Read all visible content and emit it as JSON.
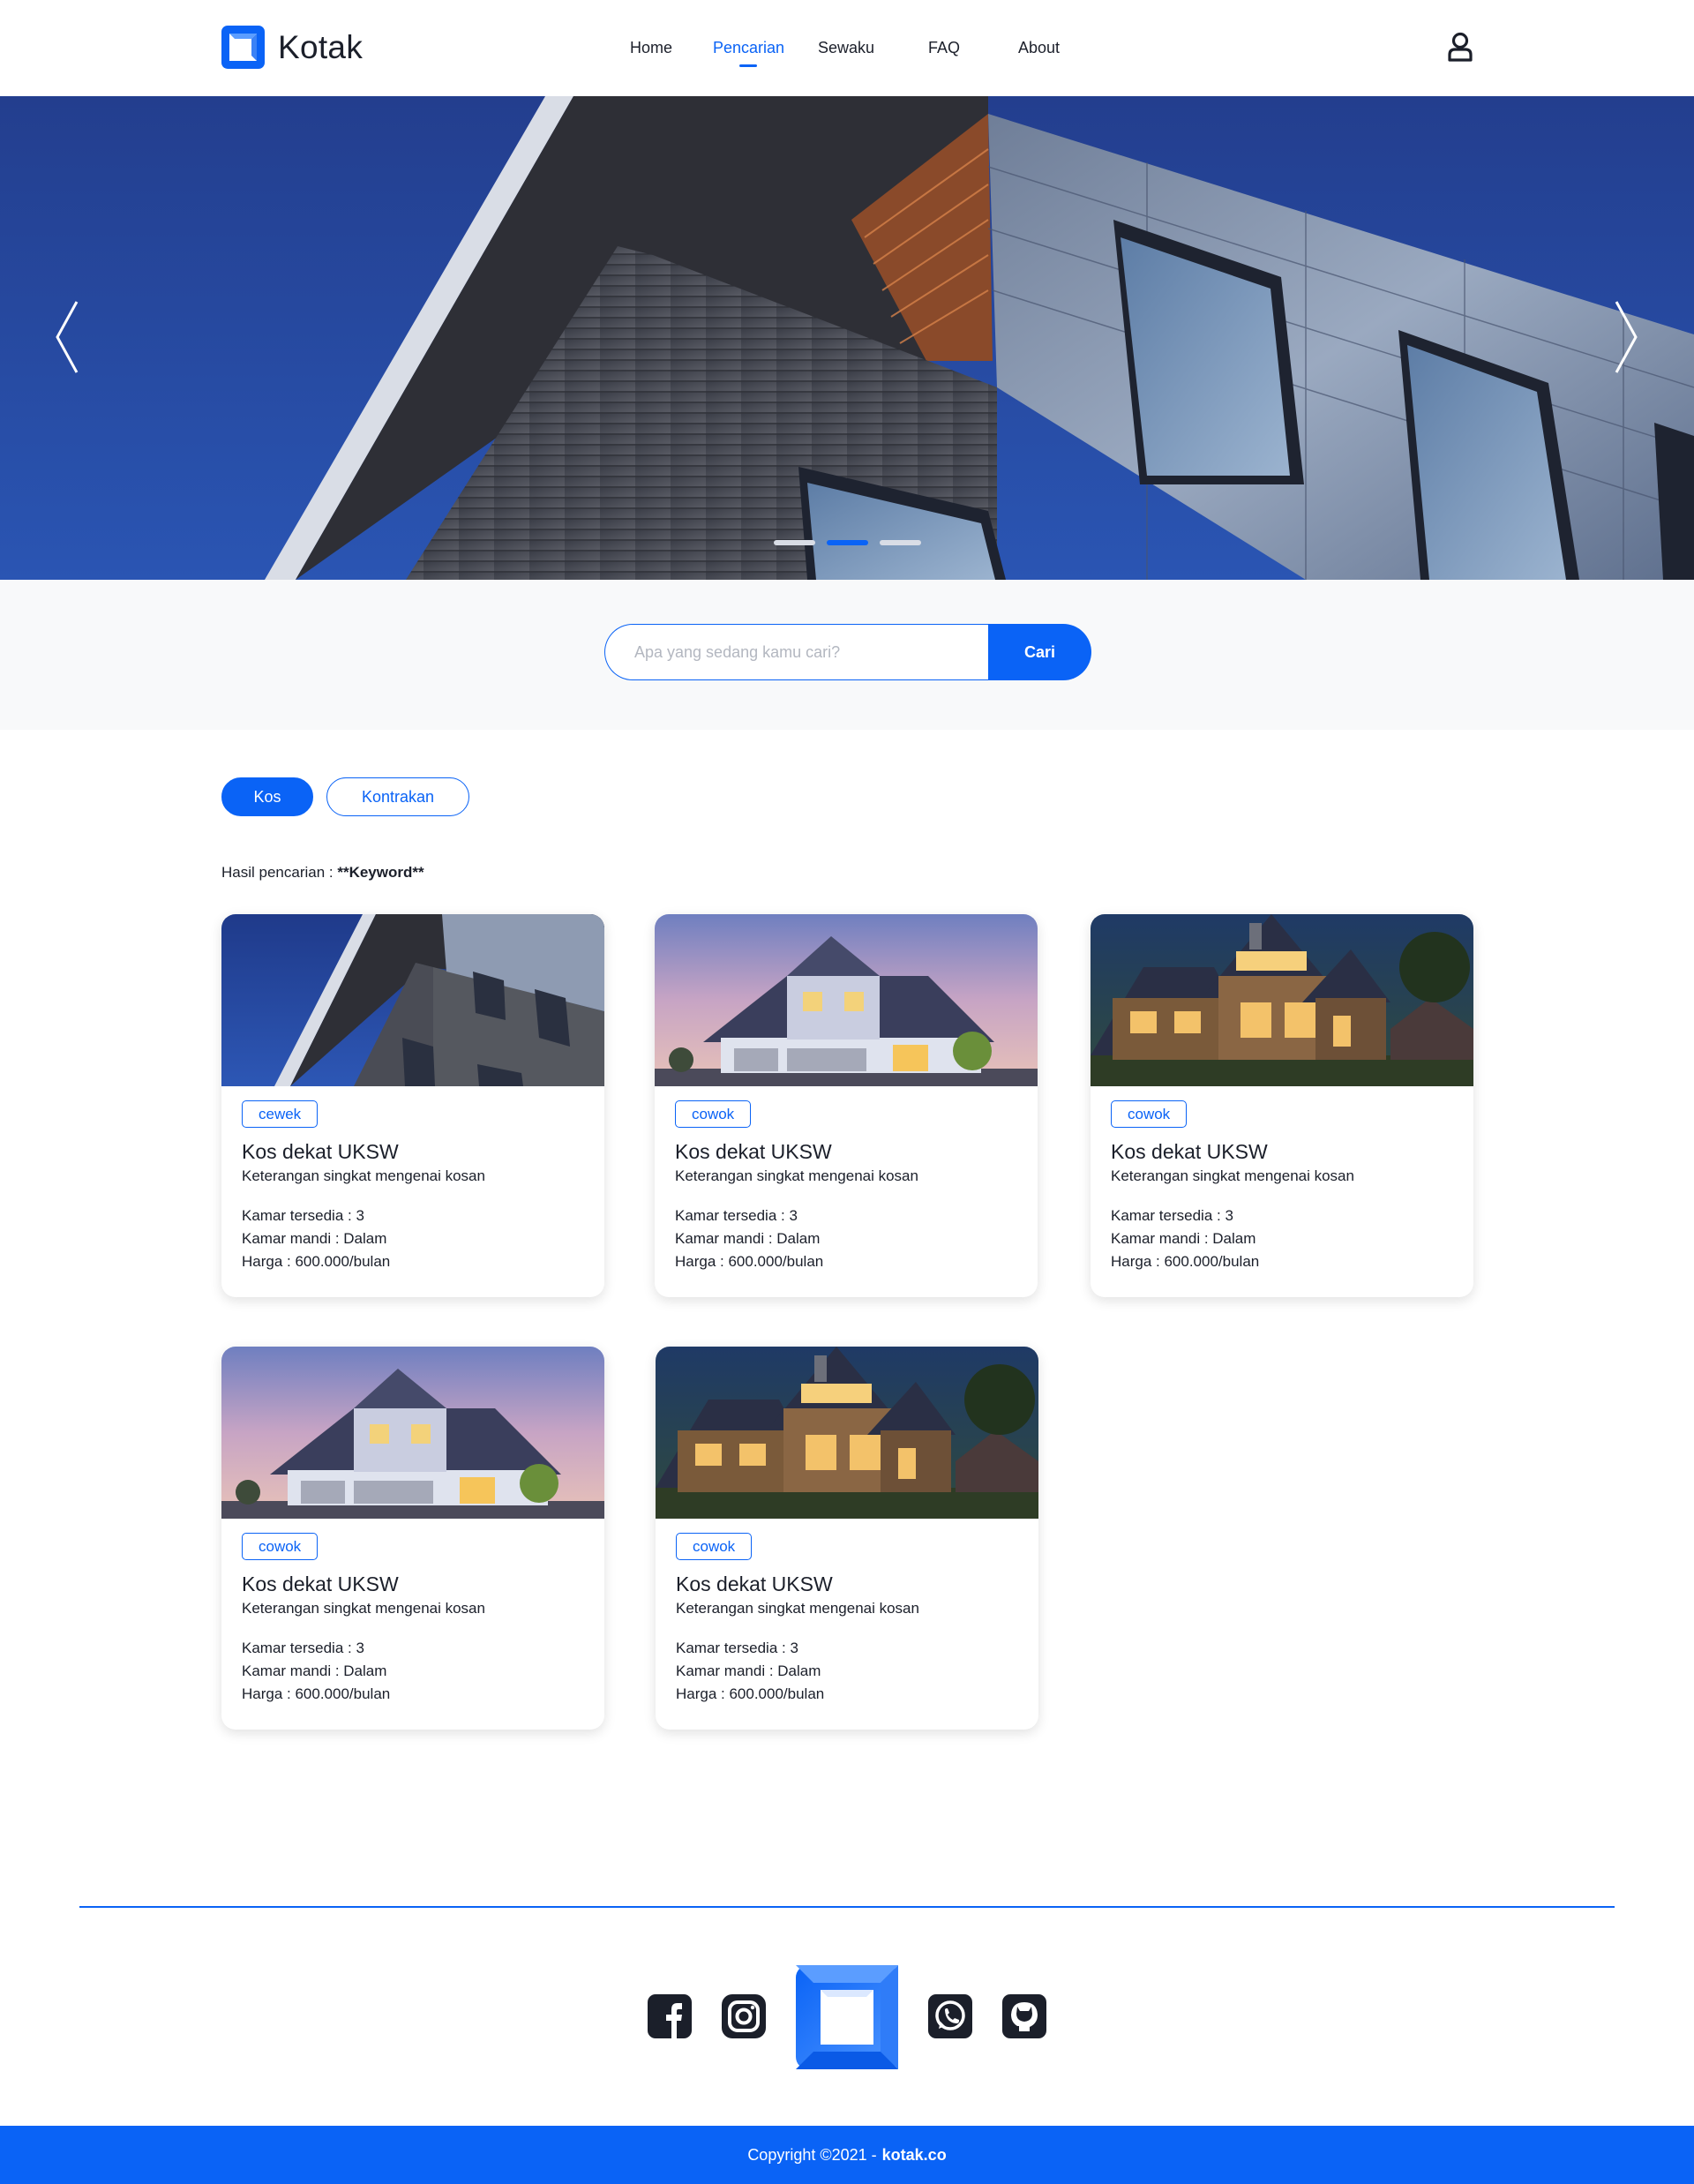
{
  "app": {
    "name": "Kotak"
  },
  "nav": {
    "items": [
      {
        "label": "Home"
      },
      {
        "label": "Pencarian",
        "active": true
      },
      {
        "label": "Sewaku"
      },
      {
        "label": "FAQ"
      },
      {
        "label": "About"
      }
    ],
    "user_icon": "user-icon"
  },
  "hero": {
    "slide_count": 3,
    "active_slide": 2,
    "prev_icon": "chevron-left-icon",
    "next_icon": "chevron-right-icon"
  },
  "search": {
    "placeholder": "Apa yang sedang kamu cari?",
    "value": "",
    "button_label": "Cari"
  },
  "filters": [
    {
      "label": "Kos",
      "active": true
    },
    {
      "label": "Kontrakan",
      "active": false
    }
  ],
  "results": {
    "prefix": "Hasil pencarian : ",
    "keyword": "**Keyword**"
  },
  "listings": [
    {
      "tag": "cewek",
      "title": "Kos dekat UKSW",
      "description": "Keterangan singkat mengenai kosan",
      "rooms": "Kamar tersedia : 3",
      "bathroom": "Kamar mandi : Dalam",
      "price": "Harga : 600.000/bulan",
      "image": "modern-building"
    },
    {
      "tag": "cowok",
      "title": "Kos dekat UKSW",
      "description": "Keterangan singkat mengenai kosan",
      "rooms": "Kamar tersedia : 3",
      "bathroom": "Kamar mandi : Dalam",
      "price": "Harga : 600.000/bulan",
      "image": "suburban-house-dusk"
    },
    {
      "tag": "cowok",
      "title": "Kos dekat UKSW",
      "description": "Keterangan singkat mengenai kosan",
      "rooms": "Kamar tersedia : 3",
      "bathroom": "Kamar mandi : Dalam",
      "price": "Harga : 600.000/bulan",
      "image": "wooden-house-night"
    },
    {
      "tag": "cowok",
      "title": "Kos dekat UKSW",
      "description": "Keterangan singkat mengenai kosan",
      "rooms": "Kamar tersedia : 3",
      "bathroom": "Kamar mandi : Dalam",
      "price": "Harga : 600.000/bulan",
      "image": "suburban-house-dusk"
    },
    {
      "tag": "cowok",
      "title": "Kos dekat UKSW",
      "description": "Keterangan singkat mengenai kosan",
      "rooms": "Kamar tersedia : 3",
      "bathroom": "Kamar mandi : Dalam",
      "price": "Harga : 600.000/bulan",
      "image": "wooden-house-night"
    }
  ],
  "footer": {
    "social": [
      "facebook-icon",
      "instagram-icon",
      "whatsapp-icon",
      "github-icon"
    ],
    "copyright": "Copyright ©2021 -",
    "site": "kotak.co"
  },
  "colors": {
    "accent": "#0a63f6",
    "hero_sky": "#24459a",
    "text": "#1b1f2a"
  }
}
